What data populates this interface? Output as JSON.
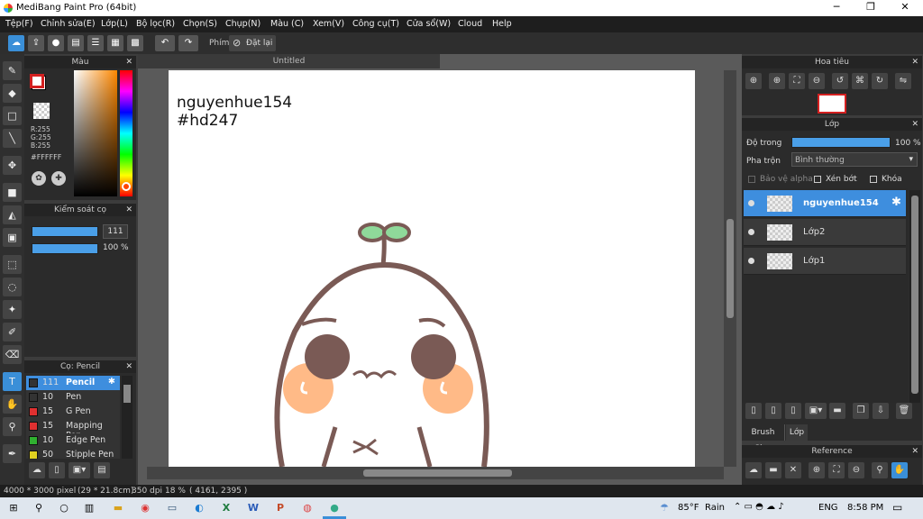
{
  "window": {
    "title": "MediBang Paint Pro (64bit)"
  },
  "menu": [
    "Tệp(F)",
    "Chỉnh sửa(E)",
    "Lớp(L)",
    "Bộ lọc(R)",
    "Chọn(S)",
    "Chụp(N)",
    "Màu (C)",
    "Xem(V)",
    "Công cụ(T)",
    "Cửa sổ(W)",
    "Cloud",
    "Help"
  ],
  "toolbar": {
    "shortcut_label": "Phím",
    "reset_label": "Đặt lại"
  },
  "color_panel": {
    "title": "Màu",
    "r": "R:255",
    "g": "G:255",
    "b": "B:255",
    "hex": "#FFFFFF",
    "main_color": "#d42020"
  },
  "brush_control": {
    "title": "Kiểm soát cọ",
    "size": "111",
    "opacity": "100 %"
  },
  "brush_panel": {
    "title": "Cọ: Pencil",
    "items": [
      {
        "size": "111",
        "name": "Pencil",
        "color": "#333333"
      },
      {
        "size": "10",
        "name": "Pen",
        "color": "#333333"
      },
      {
        "size": "15",
        "name": "G Pen",
        "color": "#e03030"
      },
      {
        "size": "15",
        "name": "Mapping Pen",
        "color": "#e03030"
      },
      {
        "size": "10",
        "name": "Edge Pen",
        "color": "#30b030"
      },
      {
        "size": "50",
        "name": "Stipple Pen",
        "color": "#e0d020"
      }
    ]
  },
  "document": {
    "tab": "Untitled",
    "text_line1": "nguyenhue154",
    "text_line2": "#hd247"
  },
  "navigator": {
    "title": "Hoa tiêu"
  },
  "layer_panel": {
    "title": "Lớp",
    "opacity_label": "Độ trong",
    "opacity_value": "100 %",
    "blend_label": "Pha trộn",
    "blend_value": "Bình thường",
    "protect_alpha": "Bảo vệ alpha",
    "clipping": "Xén bớt",
    "lock": "Khóa",
    "layers": [
      {
        "name": "nguyenhue154"
      },
      {
        "name": "Lớp2"
      },
      {
        "name": "Lớp1"
      }
    ]
  },
  "bottom_tabs": {
    "brush_size": "Brush Size",
    "layer": "Lớp"
  },
  "reference": {
    "title": "Reference"
  },
  "status": {
    "size": "4000 * 3000 pixel",
    "cm": "(29 * 21.8cm)",
    "dpi": "350 dpi",
    "zoom": "18 %",
    "coords": "( 4161, 2395 )"
  },
  "taskbar": {
    "temp": "85°F",
    "weather": "Rain",
    "lang": "ENG",
    "time": "8:58 PM"
  }
}
